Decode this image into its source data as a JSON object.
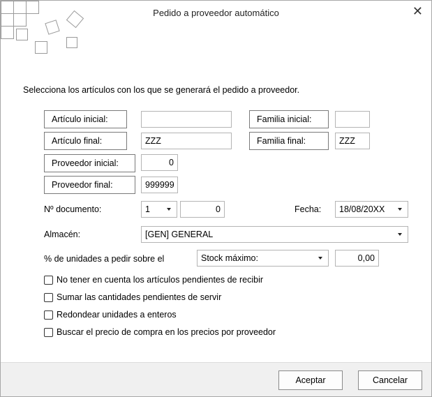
{
  "window": {
    "title": "Pedido a proveedor automático",
    "close_glyph": "✕"
  },
  "intro": "Selecciona los artículos con los que se generará el pedido a proveedor.",
  "articulo": {
    "inicial_label": "Artículo inicial:",
    "inicial_value": "",
    "final_label": "Artículo final:",
    "final_value": "ZZZ"
  },
  "familia": {
    "inicial_label": "Familia inicial:",
    "inicial_value": "",
    "final_label": "Familia final:",
    "final_value": "ZZZ"
  },
  "proveedor": {
    "inicial_label": "Proveedor inicial:",
    "inicial_value": "0",
    "final_label": "Proveedor final:",
    "final_value": "999999"
  },
  "documento": {
    "label": "Nº documento:",
    "serie": "1",
    "numero": "0"
  },
  "fecha": {
    "label": "Fecha:",
    "value": "18/08/20XX"
  },
  "almacen": {
    "label": "Almacén:",
    "value": "[GEN] GENERAL"
  },
  "unidades": {
    "label": "% de unidades a pedir sobre el",
    "base": "Stock máximo:",
    "porcentaje": "0,00"
  },
  "options": [
    {
      "label": "No tener en cuenta los artículos pendientes de recibir",
      "checked": false
    },
    {
      "label": "Sumar las cantidades pendientes de servir",
      "checked": false
    },
    {
      "label": "Redondear unidades a enteros",
      "checked": false
    },
    {
      "label": "Buscar el precio de compra en los precios por proveedor",
      "checked": false
    }
  ],
  "buttons": {
    "accept": "Aceptar",
    "cancel": "Cancelar"
  },
  "icons": {
    "decoration": "squares-grid-logo-icon",
    "close": "close-icon",
    "dropdown": "chevron-down-icon"
  }
}
